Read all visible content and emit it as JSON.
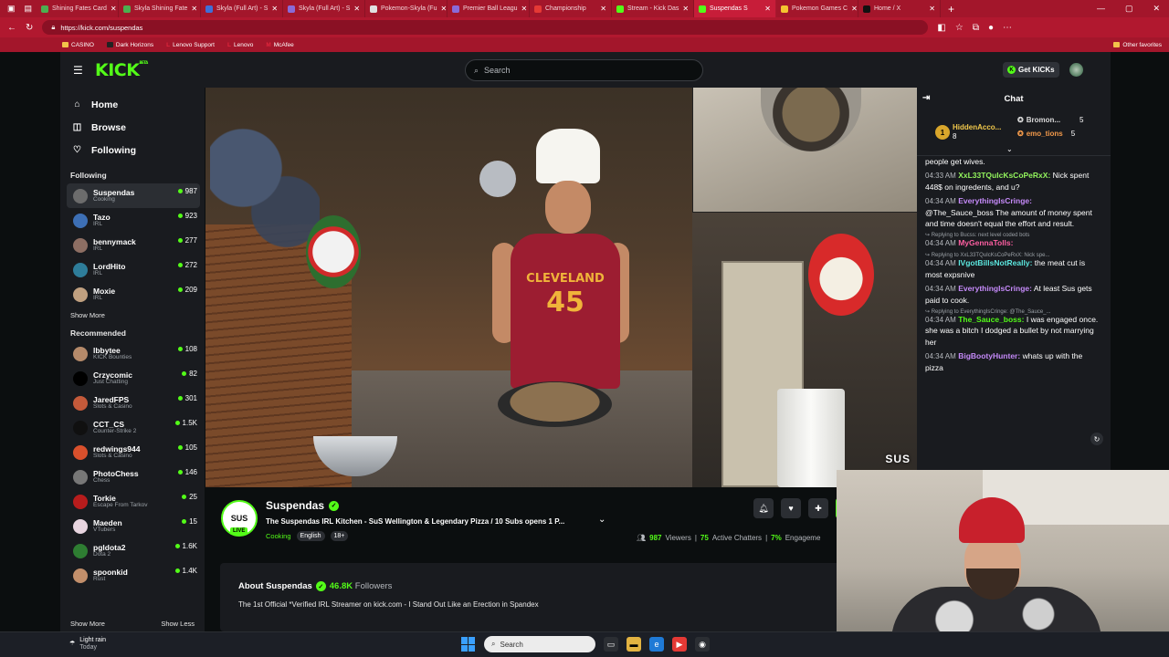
{
  "browser": {
    "tabs": [
      {
        "label": "Shining Fates Card",
        "color": "#4caf50"
      },
      {
        "label": "Skyla Shining Fate",
        "color": "#4caf50"
      },
      {
        "label": "Skyla (Full Art) - S",
        "color": "#3f6fd8"
      },
      {
        "label": "Skyla (Full Art) - S",
        "color": "#8a6ad8"
      },
      {
        "label": "Pokemon-Skyla (Fu",
        "color": "#e0e0e0"
      },
      {
        "label": "Premier Ball Leagu",
        "color": "#8a6ad8"
      },
      {
        "label": "Championship",
        "color": "#e53935"
      },
      {
        "label": "Stream - Kick Das",
        "color": "#53fc18"
      },
      {
        "label": "Suspendas S",
        "color": "#53fc18",
        "active": true
      },
      {
        "label": "Pokemon Games C",
        "color": "#f4c430"
      },
      {
        "label": "Home / X",
        "color": "#111111"
      }
    ],
    "new_tab": "+",
    "url": "https://kick.com/suspendas",
    "bookmarks": [
      "CASINO",
      "Dark Horizons",
      "Lenovo Support",
      "Lenovo",
      "McAfee"
    ],
    "other_favorites": "Other favorites"
  },
  "header": {
    "logo": "KICK",
    "logo_sup": "BETA",
    "search_placeholder": "Search",
    "get_kicks": "Get KICKs"
  },
  "sidebar": {
    "nav": [
      {
        "label": "Home",
        "icon": "⌂"
      },
      {
        "label": "Browse",
        "icon": "◫"
      },
      {
        "label": "Following",
        "icon": "♡"
      }
    ],
    "following_title": "Following",
    "following": [
      {
        "name": "Suspendas",
        "category": "Cooking",
        "viewers": "987",
        "color": "#6c6c6c"
      },
      {
        "name": "Tazo",
        "category": "IRL",
        "viewers": "923",
        "color": "#3d6fb5"
      },
      {
        "name": "bennymack",
        "category": "IRL",
        "viewers": "277",
        "color": "#8d6e63"
      },
      {
        "name": "LordHito",
        "category": "IRL",
        "viewers": "272",
        "color": "#2e7d9a"
      },
      {
        "name": "Moxie",
        "category": "IRL",
        "viewers": "209",
        "color": "#c0a080"
      }
    ],
    "show_more_following": "Show More",
    "recommended_title": "Recommended",
    "recommended": [
      {
        "name": "lbbytee",
        "category": "KICK Bounties",
        "viewers": "108",
        "color": "#b58a6a"
      },
      {
        "name": "Crzycomic",
        "category": "Just Chatting",
        "viewers": "82",
        "color": "#000000"
      },
      {
        "name": "JaredFPS",
        "category": "Slots & Casino",
        "viewers": "301",
        "color": "#c45a3a"
      },
      {
        "name": "CCT_CS",
        "category": "Counter-Strike 2",
        "viewers": "1.5K",
        "color": "#101010"
      },
      {
        "name": "redwings944",
        "category": "Slots & Casino",
        "viewers": "105",
        "color": "#d9502c"
      },
      {
        "name": "PhotoChess",
        "category": "Chess",
        "viewers": "146",
        "color": "#777777"
      },
      {
        "name": "Torkie",
        "category": "Escape From Tarkov",
        "viewers": "25",
        "color": "#b71c1c"
      },
      {
        "name": "Maeden",
        "category": "VTubers",
        "viewers": "15",
        "color": "#e8d5e0"
      },
      {
        "name": "pgldota2",
        "category": "Dota 2",
        "viewers": "1.6K",
        "color": "#2e7d32"
      },
      {
        "name": "spoonkid",
        "category": "Rust",
        "viewers": "1.4K",
        "color": "#c28f6b"
      }
    ],
    "show_more": "Show More",
    "show_less": "Show Less"
  },
  "video": {
    "watermark": "SUS",
    "jersey_text": "CLEVELAND",
    "jersey_number": "45"
  },
  "stream": {
    "channel": "Suspendas",
    "avatar_text": "SUS",
    "live": "LIVE",
    "title": "The Suspendas IRL Kitchen - SuS Wellington & Legendary Pizza / 10 Subs opens 1 P...",
    "category": "Cooking",
    "tags": [
      "English",
      "18+"
    ],
    "viewers": "987",
    "viewers_label": "Viewers",
    "chatters": "75",
    "chatters_label": "Active Chatters",
    "engagement": "7%",
    "engagement_label": "Engageme",
    "about_title": "About Suspendas",
    "followers": "46.8K",
    "followers_label": "Followers",
    "about_text": "The 1st Official *Verified IRL Streamer on kick.com - I Stand Out Like an Erection in Spandex"
  },
  "chat": {
    "title": "Chat",
    "pinned": [
      {
        "name": "HiddenAcco...",
        "count": "8",
        "color": "#f2c94c"
      },
      {
        "name": "Bromon...",
        "count": "5",
        "color": "#d9d9d9"
      },
      {
        "name": "emo_tions",
        "count": "5",
        "color": "#f2994a"
      }
    ],
    "pinned_badge": "1",
    "messages": [
      {
        "time": "",
        "user": "",
        "color": "#ffffff",
        "text": "people get wives.",
        "reply": ""
      },
      {
        "time": "04:33 AM",
        "user": "XxL33TQuIcKsCoPeRxX:",
        "color": "#93f55d",
        "text": "Nick spent 448$ on ingredents, and u?",
        "reply": ""
      },
      {
        "time": "04:34 AM",
        "user": "EverythingIsCringe:",
        "color": "#c58af9",
        "text": "@The_Sauce_boss The amount of money spent and time doesn't equal the effort and result.",
        "reply": ""
      },
      {
        "time": "04:34 AM",
        "user": "MyGennaTolls:",
        "color": "#ff5fa2",
        "text": "",
        "reply": "Replying to Bucss: next level coded bots"
      },
      {
        "time": "04:34 AM",
        "user": "IVgotBillsNotReally:",
        "color": "#5ce8e0",
        "text": "the meat cut is most expsnive",
        "reply": "Replying to XxL33TQuIcKsCoPeRxX: Nick spe..."
      },
      {
        "time": "04:34 AM",
        "user": "EverythingIsCringe:",
        "color": "#c58af9",
        "text": "At least Sus gets paid to cook.",
        "reply": ""
      },
      {
        "time": "04:34 AM",
        "user": "The_Sauce_boss:",
        "color": "#53fc18",
        "text": "I was engaged once. she was a bitch I dodged a bullet by not marrying her",
        "reply": "Replying to EverythingIsCringe: @The_Sauce_..."
      },
      {
        "time": "04:34 AM",
        "user": "BigBootyHunter:",
        "color": "#c58af9",
        "text": "whats up with the pizza",
        "reply": ""
      }
    ]
  },
  "taskbar": {
    "weather_title": "Light rain",
    "weather_sub": "Today",
    "search_placeholder": "Search"
  }
}
